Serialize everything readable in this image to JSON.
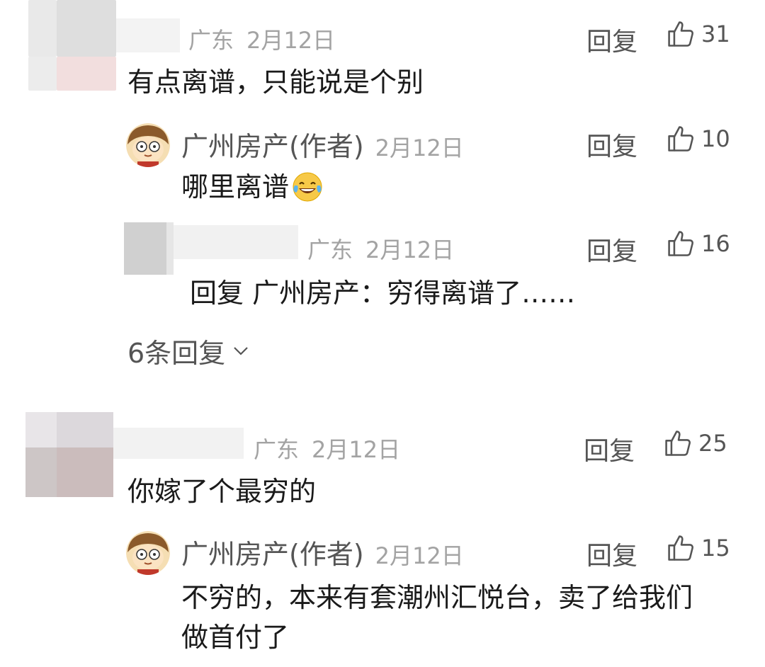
{
  "comments": [
    {
      "location": "广东",
      "date": "2月12日",
      "reply_label": "回复",
      "likes": "31",
      "text": "有点离谱，只能说是个别",
      "avatar_colors": [
        "#e9e9e9",
        "#dedede",
        "#ececec",
        "#f0dada"
      ],
      "replies": [
        {
          "author": "广州房产",
          "author_tag": "(作者)",
          "date": "2月12日",
          "reply_label": "回复",
          "likes": "10",
          "text": "哪里离谱",
          "emoji": "laughing-tears-emoji"
        },
        {
          "location": "广东",
          "date": "2月12日",
          "reply_label": "回复",
          "likes": "16",
          "text": "回复 广州房产：穷得离谱了……"
        }
      ],
      "more_replies": "6条回复"
    },
    {
      "location": "广东",
      "date": "2月12日",
      "reply_label": "回复",
      "likes": "25",
      "text": "你嫁了个最穷的",
      "avatar_colors": [
        "#e6e3e6",
        "#dcd8dc",
        "#c9c2c2",
        "#cbbcbc"
      ],
      "replies": [
        {
          "author": "广州房产",
          "author_tag": "(作者)",
          "date": "2月12日",
          "reply_label": "回复",
          "likes": "15",
          "text_line1": "不穷的，本来有套潮州汇悦台，卖了给我们",
          "text_line2": "做首付了"
        }
      ]
    }
  ],
  "colors": {
    "text": "#1a1a1a",
    "secondary": "#555555",
    "meta": "#a3a3a3"
  }
}
